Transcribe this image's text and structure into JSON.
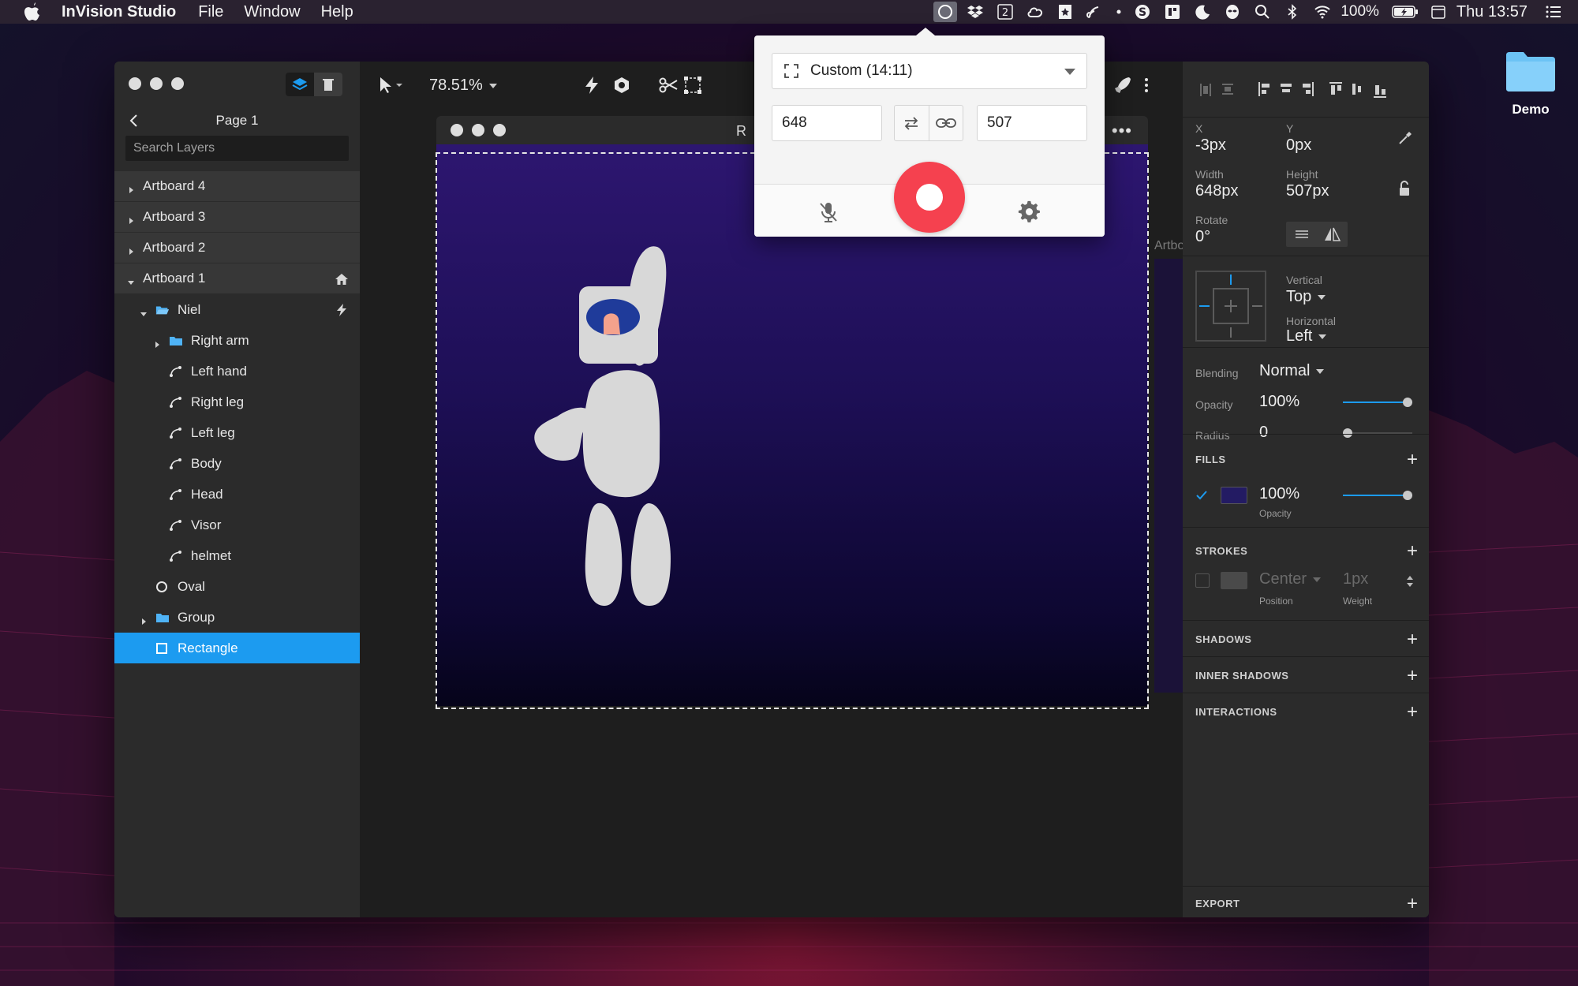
{
  "menubar": {
    "app_name": "InVision Studio",
    "menus": [
      "File",
      "Window",
      "Help"
    ],
    "battery": "100%",
    "clock": "Thu 13:57",
    "status_icons": [
      "record-circle-icon",
      "dropbox-icon",
      "two-badge-icon",
      "creative-cloud-icon",
      "bookmark-icon",
      "broadcast-icon",
      "dot-icon",
      "skype-icon",
      "grid-icon",
      "moon-icon",
      "alien-icon",
      "search-icon",
      "bluetooth-icon",
      "wifi-icon",
      "battery-icon",
      "calendar-icon",
      "menu-icon"
    ]
  },
  "desktop": {
    "folder_label": "Demo"
  },
  "layers": {
    "page_title": "Page 1",
    "search_placeholder": "Search Layers",
    "items": [
      {
        "label": "Artboard 4",
        "type": "artboard",
        "indent": 0,
        "chevron": "right"
      },
      {
        "label": "Artboard 3",
        "type": "artboard",
        "indent": 0,
        "chevron": "right"
      },
      {
        "label": "Artboard 2",
        "type": "artboard",
        "indent": 0,
        "chevron": "right"
      },
      {
        "label": "Artboard 1",
        "type": "artboard",
        "indent": 0,
        "chevron": "down",
        "trail": "home-icon"
      },
      {
        "label": "Niel",
        "type": "folder-open",
        "indent": 1,
        "chevron": "down",
        "trail": "lightning-icon"
      },
      {
        "label": "Right arm",
        "type": "folder",
        "indent": 2,
        "chevron": "right"
      },
      {
        "label": "Left hand",
        "type": "path",
        "indent": 2
      },
      {
        "label": "Right leg",
        "type": "path",
        "indent": 2
      },
      {
        "label": "Left leg",
        "type": "path",
        "indent": 2
      },
      {
        "label": "Body",
        "type": "path",
        "indent": 2
      },
      {
        "label": "Head",
        "type": "path",
        "indent": 2
      },
      {
        "label": "Visor",
        "type": "path",
        "indent": 2
      },
      {
        "label": "helmet",
        "type": "path",
        "indent": 2
      },
      {
        "label": "Oval",
        "type": "oval",
        "indent": 1
      },
      {
        "label": "Group",
        "type": "folder",
        "indent": 1,
        "chevron": "right"
      },
      {
        "label": "Rectangle",
        "type": "rect",
        "indent": 1,
        "selected": true
      }
    ]
  },
  "canvas": {
    "zoom": "78.51%",
    "preview_title_fragment": "R",
    "side_artboard_label": "Artbo",
    "artboard_bg": "#1d0f55"
  },
  "recorder": {
    "preset": "Custom (14:11)",
    "width": "648",
    "height": "507"
  },
  "inspector": {
    "x_label": "X",
    "x_value": "-3px",
    "y_label": "Y",
    "y_value": "0px",
    "width_label": "Width",
    "width_value": "648px",
    "height_label": "Height",
    "height_value": "507px",
    "rotate_label": "Rotate",
    "rotate_value": "0°",
    "vertical_label": "Vertical",
    "vertical_value": "Top",
    "horizontal_label": "Horizontal",
    "horizontal_value": "Left",
    "blending_label": "Blending",
    "blending_value": "Normal",
    "opacity_label": "Opacity",
    "opacity_value": "100%",
    "opacity_level": 1.0,
    "radius_label": "Radius",
    "radius_value": "0",
    "radius_level": 0.0,
    "fills_title": "FILLS",
    "fill_color": "#231b63",
    "fill_opacity": "100%",
    "fill_opacity_label": "Opacity",
    "fill_opacity_level": 1.0,
    "strokes_title": "STROKES",
    "stroke_position": "Center",
    "stroke_position_label": "Position",
    "stroke_weight": "1px",
    "stroke_weight_label": "Weight",
    "shadows_title": "SHADOWS",
    "inner_shadows_title": "INNER SHADOWS",
    "interactions_title": "INTERACTIONS",
    "export_title": "EXPORT"
  },
  "colors": {
    "accent": "#1c9bf0",
    "record": "#f5414f"
  }
}
